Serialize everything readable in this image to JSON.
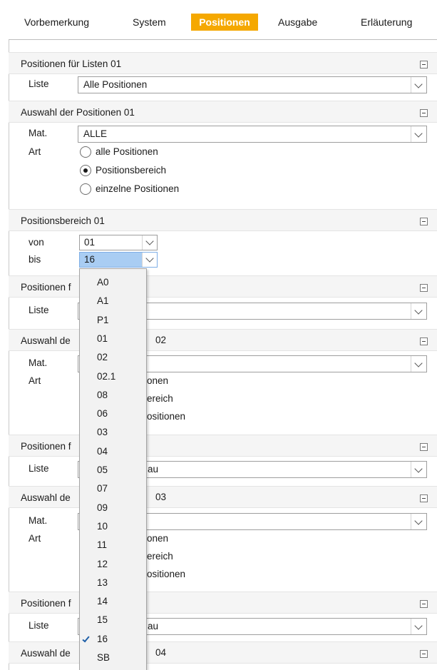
{
  "tabs": [
    "Vorbemerkung",
    "System",
    "Positionen",
    "Ausgabe",
    "Erläuterung"
  ],
  "active_tab": "Positionen",
  "colors": {
    "accent": "#f5a800",
    "selection": "#a9cdf3",
    "check": "#1e5fa8"
  },
  "sections": [
    {
      "title": "Positionen für Listen 01",
      "liste_label": "Liste",
      "liste_value": "Alle Positionen"
    },
    {
      "title": "Auswahl der Positionen 01",
      "mat_label": "Mat.",
      "mat_value": "ALLE",
      "art_label": "Art",
      "radios": [
        {
          "label": "alle Positionen",
          "checked": false
        },
        {
          "label": "Positionsbereich",
          "checked": true
        },
        {
          "label": "einzelne Positionen",
          "checked": false
        }
      ]
    },
    {
      "title": "Positionsbereich 01",
      "von_label": "von",
      "von_value": "01",
      "bis_label": "bis",
      "bis_value": "16"
    },
    {
      "title": "Positionen f",
      "liste_label": "Liste",
      "liste_value": ""
    },
    {
      "title": "Auswahl de",
      "title_tail": "02",
      "mat_label": "Mat.",
      "mat_value": "",
      "art_label": "Art",
      "radio_fragments": [
        "onen",
        "ereich",
        "ositionen"
      ]
    },
    {
      "title": "Positionen f",
      "liste_label": "Liste",
      "liste_value": "au"
    },
    {
      "title": "Auswahl de",
      "title_tail": "03",
      "mat_label": "Mat.",
      "mat_value": "",
      "art_label": "Art",
      "radio_fragments": [
        "onen",
        "ereich",
        "ositionen"
      ]
    },
    {
      "title": "Positionen f",
      "liste_label": "Liste",
      "liste_value": "au"
    },
    {
      "title": "Auswahl de",
      "title_tail": "04"
    }
  ],
  "dropdown": {
    "items": [
      "A0",
      "A1",
      "P1",
      "01",
      "02",
      "02.1",
      "08",
      "06",
      "03",
      "04",
      "05",
      "07",
      "09",
      "10",
      "11",
      "12",
      "13",
      "14",
      "15",
      "16",
      "SB"
    ],
    "selected": "16"
  },
  "icons": {
    "collapse": "collapse-minus-icon",
    "chevron": "chevron-down-icon",
    "check": "checkmark-icon"
  }
}
